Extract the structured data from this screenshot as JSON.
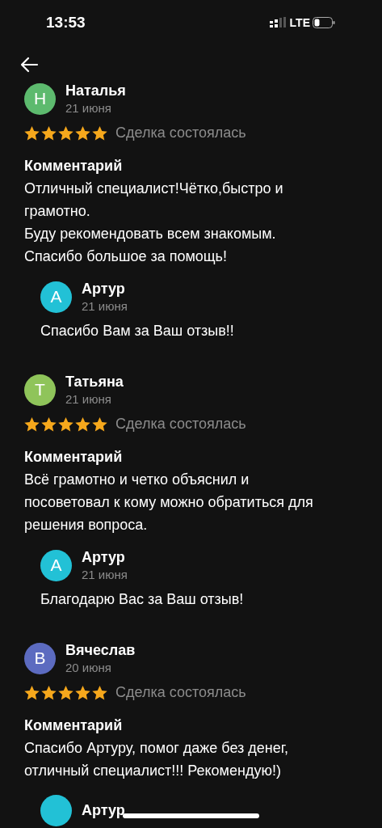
{
  "status_bar": {
    "time": "13:53",
    "network": "LTE"
  },
  "reviews": [
    {
      "name": "Наталья",
      "avatar": {
        "letter": "Н",
        "color": "#5dba6e"
      },
      "date": "21 июня",
      "stars": 5,
      "status": "Сделка состоялась",
      "comment_label": "Комментарий",
      "comment": "Отличный специалист!Чётко,быстро и грамотно.\nБуду рекомендовать всем знакомым.\nСпасибо большое за помощь!",
      "reply": {
        "name": "Артур",
        "avatar": {
          "letter": "А",
          "color": "#22c1d6"
        },
        "date": "21 июня",
        "text": "Спасибо Вам за Ваш отзыв!!"
      }
    },
    {
      "name": "Татьяна",
      "avatar": {
        "letter": "Т",
        "color": "#8fc45a"
      },
      "date": "21 июня",
      "stars": 5,
      "status": "Сделка состоялась",
      "comment_label": "Комментарий",
      "comment": "Всё грамотно и четко объяснил и посоветовал к кому можно обратиться для решения вопроса.",
      "reply": {
        "name": "Артур",
        "avatar": {
          "letter": "А",
          "color": "#22c1d6"
        },
        "date": "21 июня",
        "text": "Благодарю Вас за Ваш отзыв!"
      }
    },
    {
      "name": "Вячеслав",
      "avatar": {
        "letter": "В",
        "color": "#5c6bc0"
      },
      "date": "20 июня",
      "stars": 5,
      "status": "Сделка состоялась",
      "comment_label": "Комментарий",
      "comment": "Спасибо Артуру, помог даже без денег, отличный специалист!!! Рекомендую!)",
      "reply": {
        "name": "Артур",
        "avatar": {
          "color": "#22c1d6"
        }
      }
    }
  ]
}
